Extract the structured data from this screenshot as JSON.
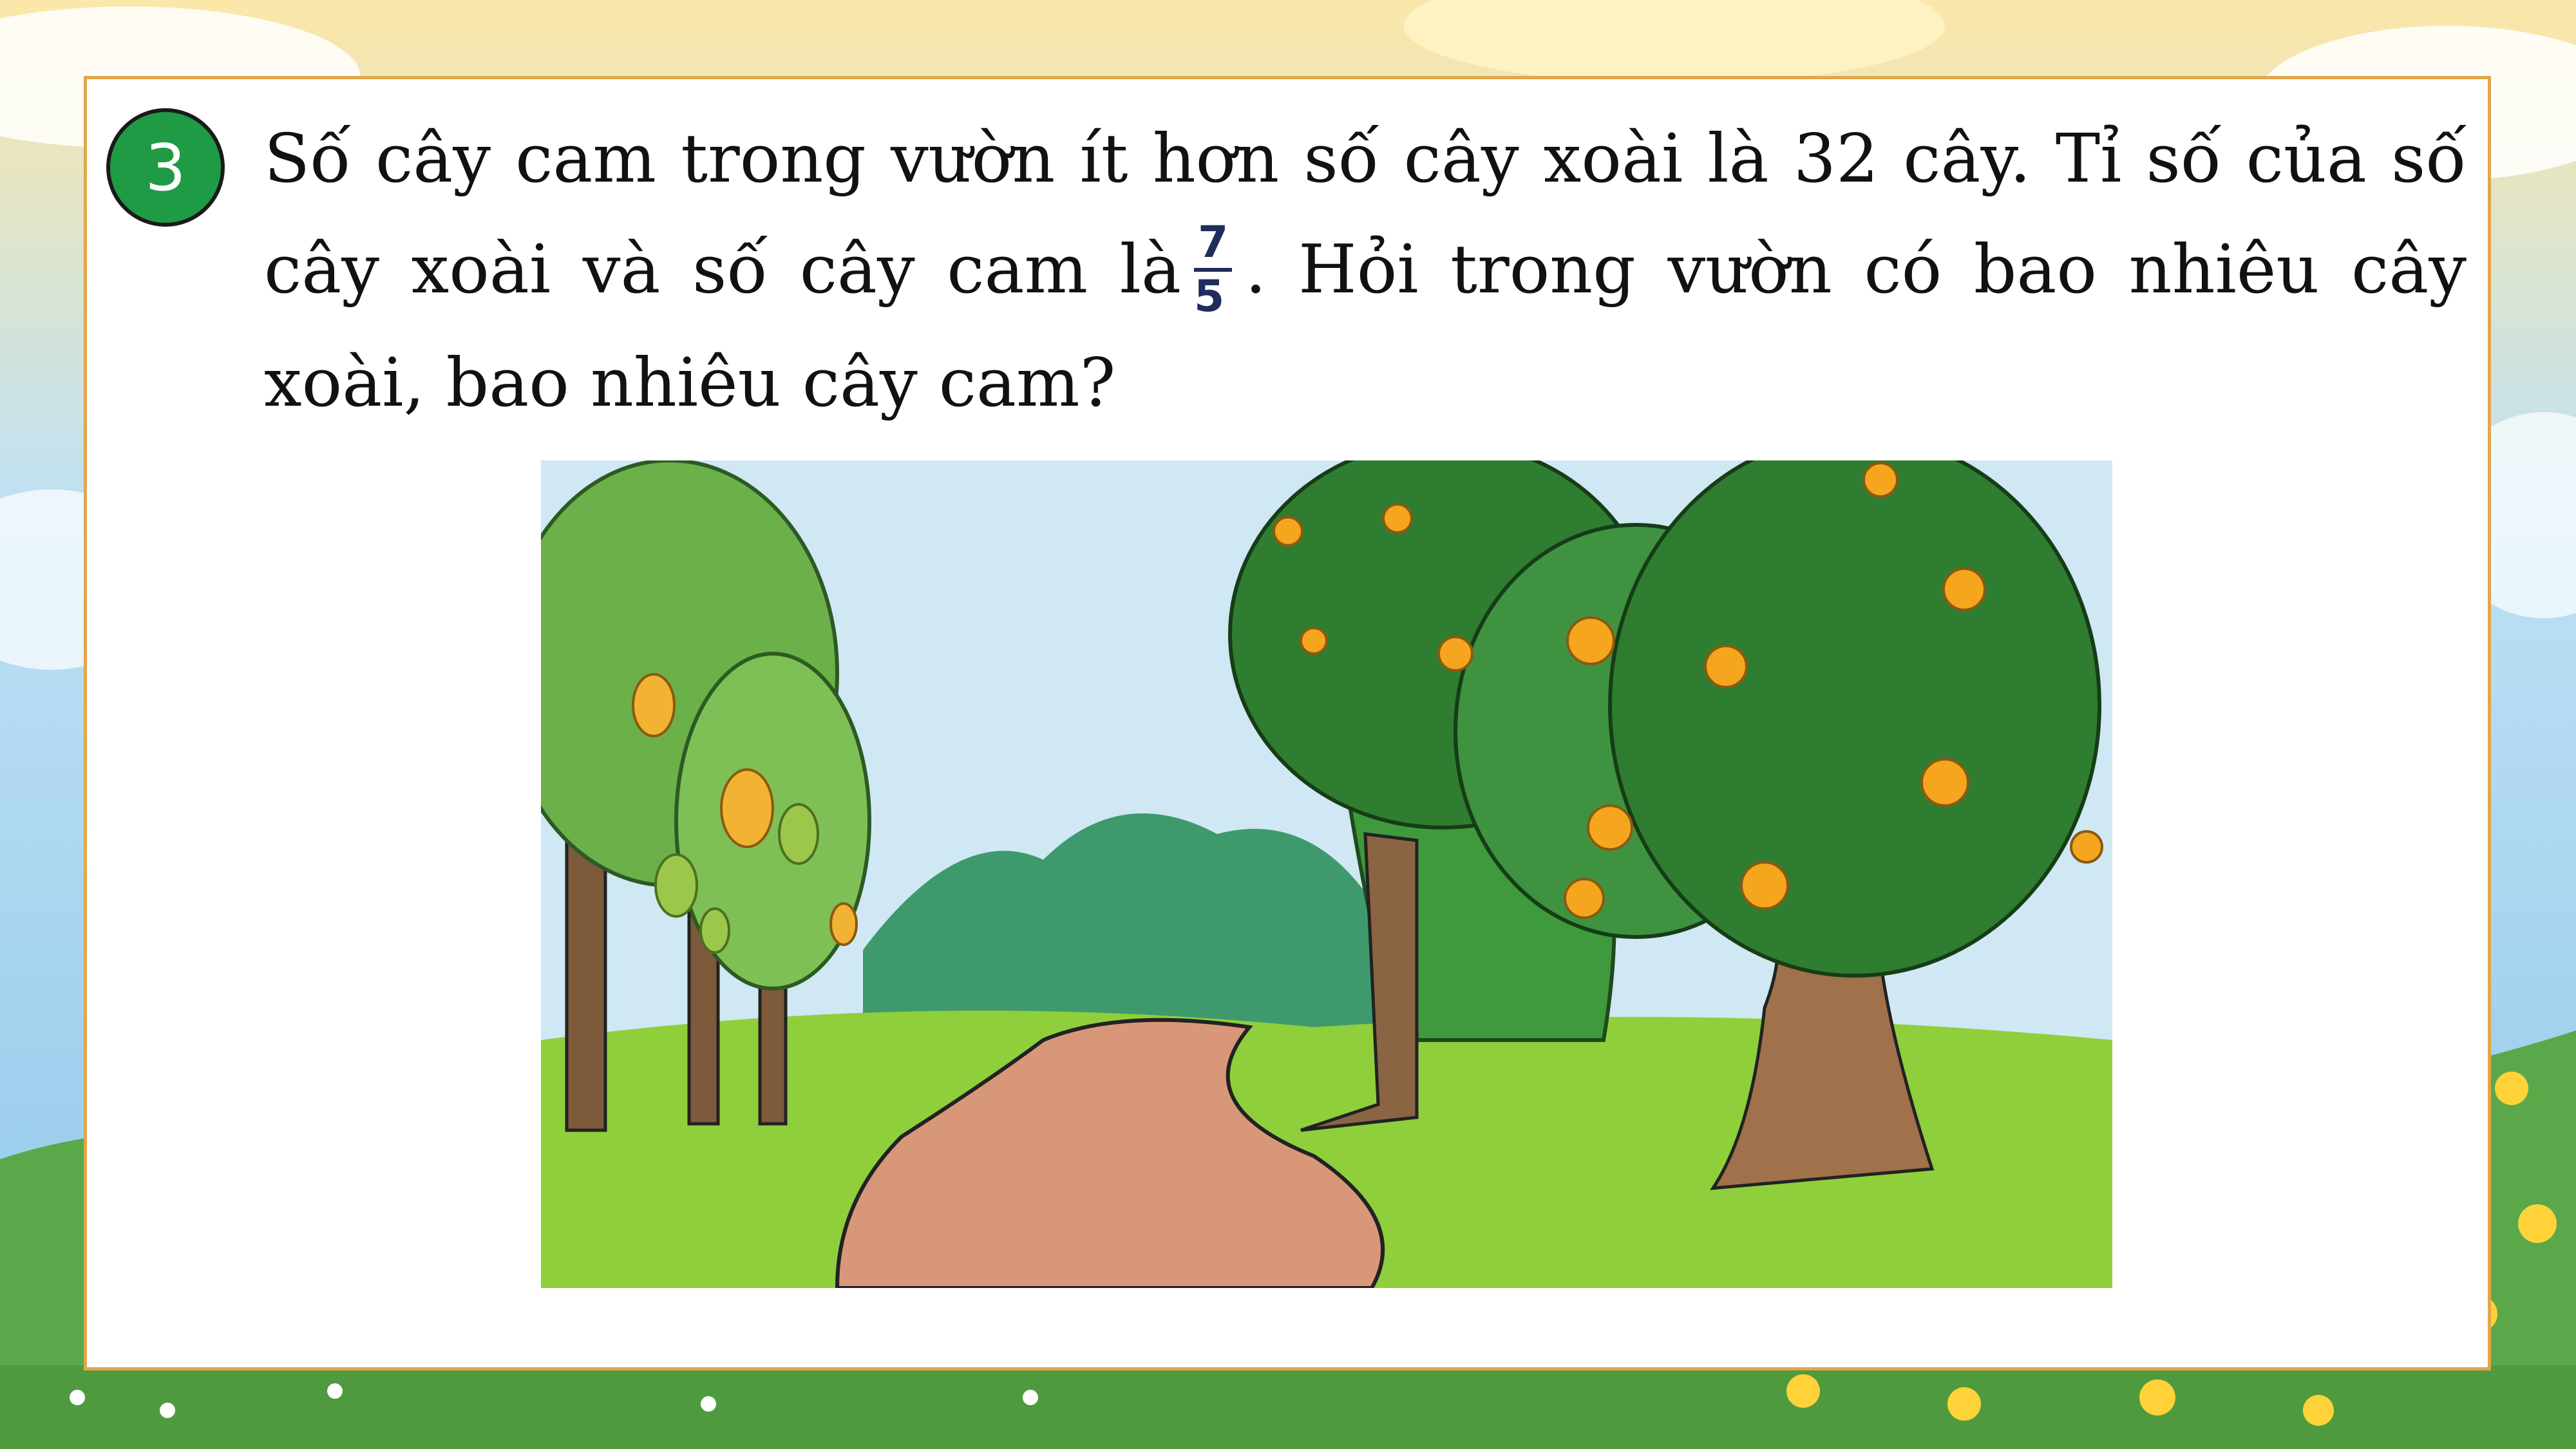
{
  "problem": {
    "number": "3",
    "text_part1": "Số cây cam trong vườn ít hơn số cây xoài là 32 cây. Tỉ số của số cây xoài và số cây cam là",
    "fraction": {
      "numerator": "7",
      "denominator": "5"
    },
    "text_part2": ". Hỏi trong vườn có bao nhiêu cây xoài, bao nhiêu cây cam?"
  },
  "colors": {
    "badge": "#1f9a45",
    "frame_border": "#e2a64a",
    "fraction_text": "#1f2d5c",
    "sky": "#9ed0ef",
    "grass": "#8fcf3c",
    "path": "#d9977a"
  },
  "illustration": {
    "subject": "orchard-path-with-mango-and-orange-trees"
  }
}
